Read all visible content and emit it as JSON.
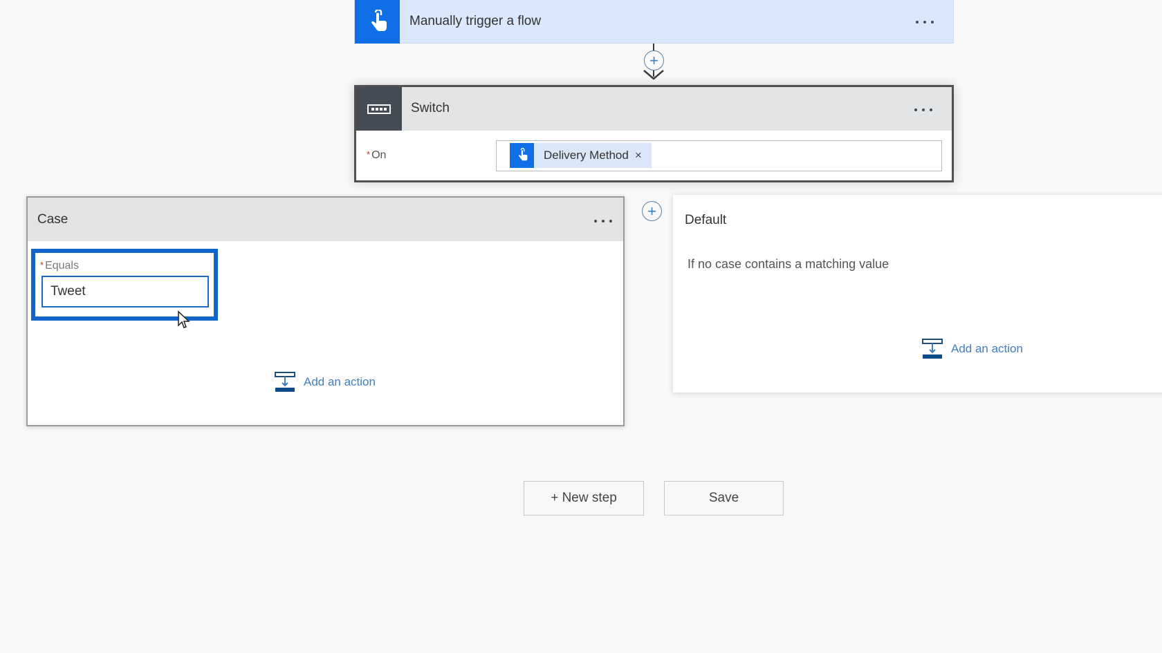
{
  "trigger": {
    "icon": "hand-pointer-icon",
    "title": "Manually trigger a flow",
    "menu_icon": "more-options-icon",
    "accent": "#0f6fe6"
  },
  "connector": {
    "plus_icon": "plus-circle-icon",
    "arrow_icon": "arrow-down-icon"
  },
  "switch": {
    "icon": "switch-icon",
    "title": "Switch",
    "on_required": "*",
    "on_label": "On",
    "token": {
      "icon": "hand-pointer-icon",
      "label": "Delivery Method",
      "remove": "×"
    }
  },
  "case": {
    "title": "Case",
    "equals_required": "*",
    "equals_label": "Equals",
    "equals_value": "Tweet",
    "add_action": "Add an action",
    "highlight_color": "#1266c9"
  },
  "add_case_icon": "plus-circle-icon",
  "default": {
    "title": "Default",
    "description": "If no case contains a matching value",
    "add_action": "Add an action"
  },
  "buttons": {
    "new_step": "+ New step",
    "save": "Save"
  }
}
